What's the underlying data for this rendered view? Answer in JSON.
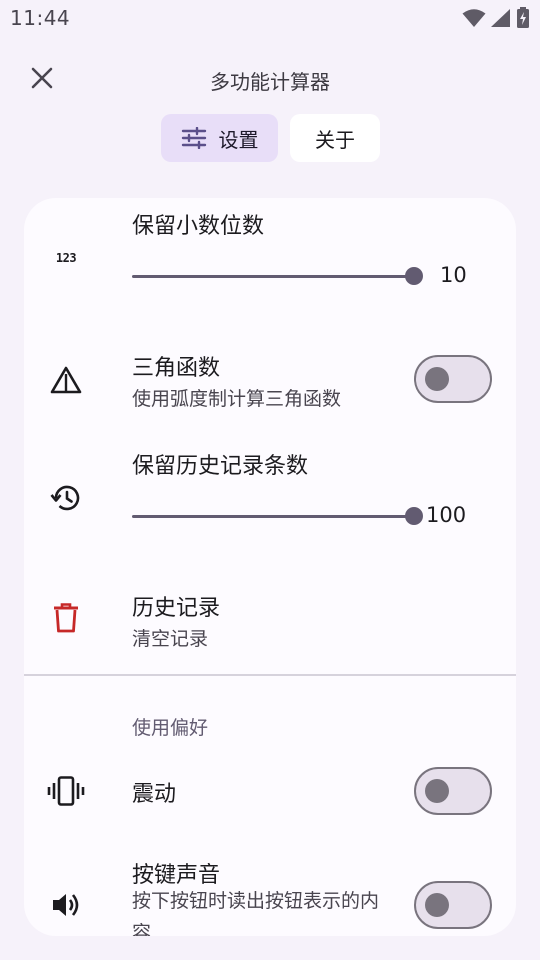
{
  "status_bar": {
    "time": "11:44",
    "icons": [
      "wifi-icon",
      "cellular-signal-icon",
      "battery-charging-icon"
    ]
  },
  "header": {
    "title": "多功能计算器",
    "close_icon": "close-icon"
  },
  "tabs": [
    {
      "label": "设置",
      "icon": "tune-icon",
      "selected": true
    },
    {
      "label": "关于",
      "selected": false
    }
  ],
  "settings": {
    "decimal_places": {
      "title": "保留小数位数",
      "icon": "numbers-icon",
      "icon_text": "123",
      "value": "10",
      "level": 1.0
    },
    "trig": {
      "title": "三角函数",
      "subtitle": "使用弧度制计算三角函数",
      "icon": "triangle-warning-icon",
      "enabled": false
    },
    "history_count": {
      "title": "保留历史记录条数",
      "icon": "history-icon",
      "value": "100",
      "level": 1.0
    },
    "history_clear": {
      "title": "历史记录",
      "subtitle": "清空记录",
      "icon": "delete-icon"
    }
  },
  "preferences": {
    "section_label": "使用偏好",
    "vibration": {
      "title": "震动",
      "icon": "vibration-icon",
      "enabled": false
    },
    "key_sound": {
      "title": "按键声音",
      "subtitle": "按下按钮时读出按钮表示的内容",
      "icon": "volume-icon",
      "enabled": false
    }
  },
  "colors": {
    "accent": "#625b71",
    "tab_selected_bg": "#e8def8",
    "delete_red": "#c62828",
    "background": "#f6f2fa",
    "card": "#fdfbff"
  }
}
